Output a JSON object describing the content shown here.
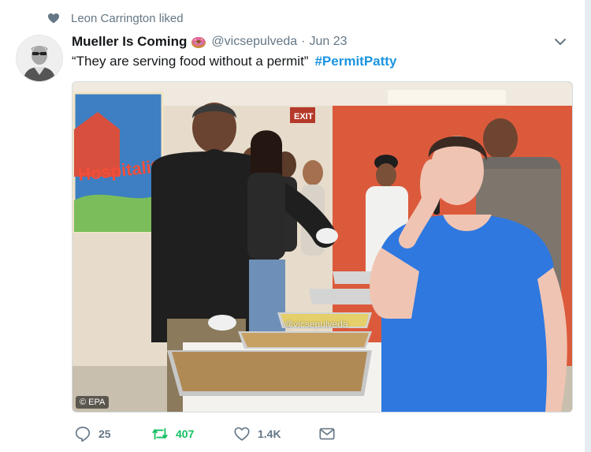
{
  "context": {
    "text": "Leon Carrington liked",
    "icon": "heart-icon"
  },
  "tweet": {
    "display_name": "Mueller Is Coming",
    "name_emoji": "donut-emoji",
    "handle": "@vicsepulveda",
    "separator": "·",
    "date": "Jun 23",
    "text": "“They are serving food without a permit”",
    "hashtag": "#PermitPatty"
  },
  "media": {
    "credit": "© EPA",
    "watermark": "@vicsepulveda",
    "sign_text": "EXIT",
    "mural_text": "Hospitality"
  },
  "actions": {
    "reply_count": "25",
    "retweet_count": "407",
    "like_count": "1.4K"
  },
  "colors": {
    "link": "#1b95e0",
    "retweet_active": "#17bf63",
    "muted": "#657786",
    "text": "#14171a"
  }
}
